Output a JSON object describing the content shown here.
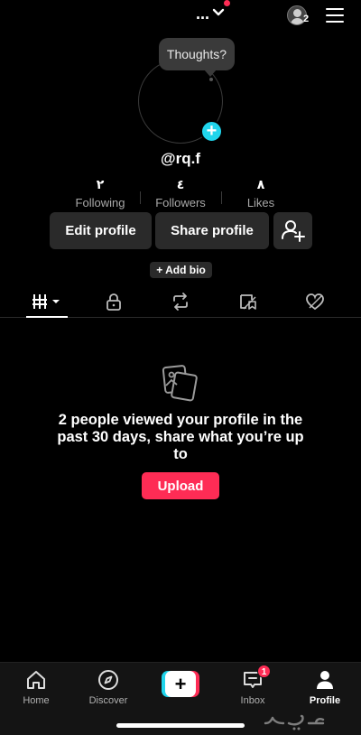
{
  "top_bar": {
    "account_switch_label": "...",
    "account_switch_icon": "chevron-down-icon",
    "friends_count": "2",
    "menu_icon": "hamburger-menu-icon"
  },
  "profile": {
    "thoughts_placeholder": "Thoughts?",
    "username": "@rq.f",
    "stats": [
      {
        "value": "٢",
        "label": "Following"
      },
      {
        "value": "٤",
        "label": "Followers"
      },
      {
        "value": "٨",
        "label": "Likes"
      }
    ],
    "edit_profile_label": "Edit profile",
    "share_profile_label": "Share profile",
    "add_bio_label": "+ Add bio"
  },
  "tabs": [
    {
      "icon": "videos-grid-icon",
      "active": true
    },
    {
      "icon": "lock-icon",
      "active": false
    },
    {
      "icon": "repost-icon",
      "active": false
    },
    {
      "icon": "favorites-icon",
      "active": false
    },
    {
      "icon": "liked-icon",
      "active": false
    }
  ],
  "empty_state": {
    "message": "2 people viewed your profile in the past 30 days, share what you’re up to",
    "upload_label": "Upload"
  },
  "bottom_nav": {
    "items": [
      {
        "label": "Home",
        "icon": "home-icon"
      },
      {
        "label": "Discover",
        "icon": "compass-icon"
      },
      {
        "label": "",
        "icon": "create-plus-icon"
      },
      {
        "label": "Inbox",
        "icon": "inbox-icon",
        "badge": "1"
      },
      {
        "label": "Profile",
        "icon": "profile-icon",
        "active": true
      }
    ]
  },
  "colors": {
    "accent_red": "#fe2c55",
    "accent_cyan": "#20d5ec",
    "background": "#000000"
  }
}
